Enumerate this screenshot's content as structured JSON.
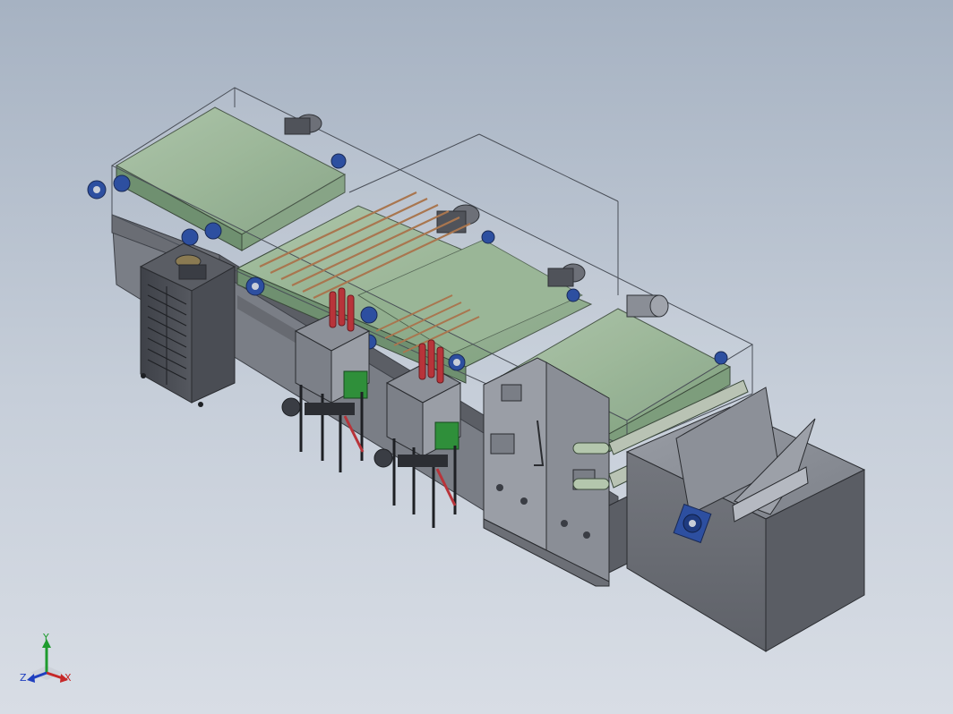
{
  "viewport": {
    "background_top": "#a6b2c2",
    "background_bottom": "#d8dde5"
  },
  "colors": {
    "belt": "#8fae8c",
    "belt_dark": "#6f9070",
    "frame": "#5c5f66",
    "frame_light": "#8b8f97",
    "housing": "#6c6f76",
    "bearing_blue": "#2d4fa0",
    "pump_red": "#b8343a",
    "valve_green": "#2f8f3a",
    "rod_copper": "#a9764f",
    "glass_edge": "#4a4f58"
  },
  "triad": {
    "y_label": "Y",
    "z_label": "Z",
    "x_label": "X",
    "y_color": "#1e9b2e",
    "x_color": "#c62828",
    "z_color": "#1f3fbf"
  }
}
